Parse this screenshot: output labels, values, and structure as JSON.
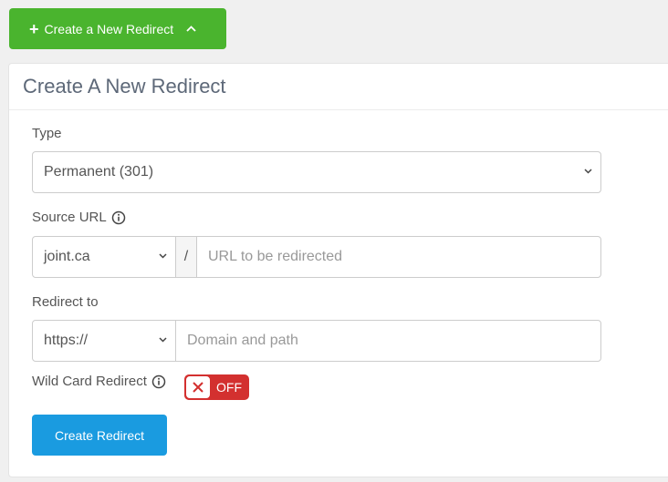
{
  "top_button": {
    "label": "Create a New Redirect"
  },
  "card": {
    "title": "Create A New Redirect"
  },
  "type_field": {
    "label": "Type",
    "value": "Permanent (301)"
  },
  "source_field": {
    "label": "Source URL",
    "domain": "joint.ca",
    "separator": "/",
    "placeholder": "URL to be redirected"
  },
  "redirect_field": {
    "label": "Redirect to",
    "protocol": "https://",
    "placeholder": "Domain and path"
  },
  "wildcard": {
    "label": "Wild Card Redirect",
    "state": "OFF"
  },
  "submit": {
    "label": "Create Redirect"
  },
  "colors": {
    "primary_green": "#4ab42e",
    "primary_blue": "#1a9be0",
    "toggle_off_red": "#d3302f"
  },
  "icons": [
    "plus-icon",
    "chevron-up-icon",
    "info-icon",
    "caret-down-icon",
    "x-icon"
  ]
}
